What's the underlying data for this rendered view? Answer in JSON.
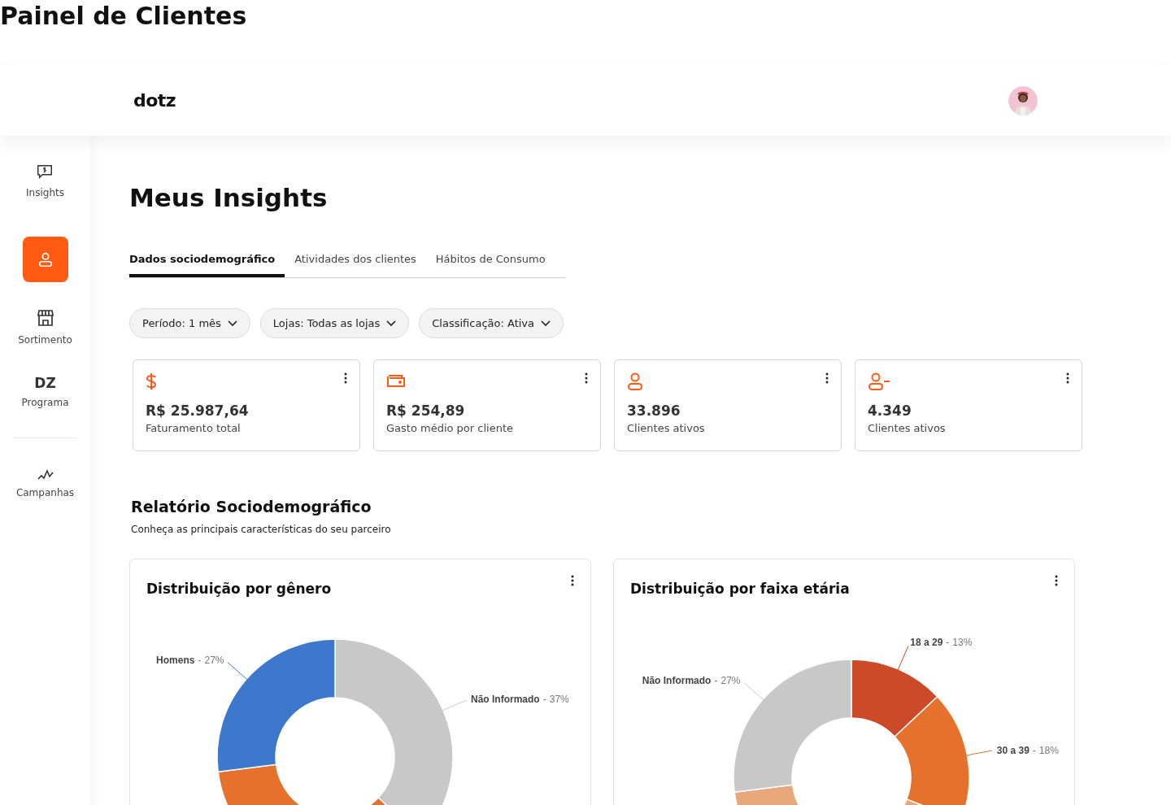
{
  "page_title": "Painel de Clientes",
  "header": {
    "logo": "dotz"
  },
  "sidebar": {
    "items": [
      {
        "label": "Insights",
        "selected": false
      },
      {
        "selected": true
      },
      {
        "label": "Sortimento",
        "selected": false
      },
      {
        "label": "Programa",
        "icon_text": "DZ",
        "selected": false
      },
      {
        "label": "Campanhas",
        "selected": false
      }
    ]
  },
  "main": {
    "title": "Meus Insights",
    "tabs": [
      {
        "label": "Dados sociodemográfico",
        "selected": true
      },
      {
        "label": "Atividades dos clientes",
        "selected": false
      },
      {
        "label": "Hábitos de Consumo",
        "selected": false
      }
    ],
    "filters": [
      {
        "label": "Período: 1 mês"
      },
      {
        "label": "Lojas: Todas as lojas"
      },
      {
        "label": "Classificação: Ativa"
      }
    ],
    "stats": [
      {
        "kind": "dollar",
        "value": "R$ 25.987,64",
        "label": "Faturamento total"
      },
      {
        "kind": "wallet",
        "value": "R$ 254,89",
        "label": "Gasto médio por cliente"
      },
      {
        "kind": "user",
        "value": "33.896",
        "label": "Clientes ativos"
      },
      {
        "kind": "user-minus",
        "value": "4.349",
        "label": "Clientes ativos"
      }
    ],
    "report": {
      "title": "Relatório Sociodemográfico",
      "subtitle": "Conheça as principais características do seu parceiro",
      "charts": [
        {
          "title": "Distribuição por gênero",
          "label_separator": "-",
          "chart_data": {
            "type": "donut",
            "categories": [
              "Não Informado",
              null,
              "Homens"
            ],
            "values": [
              37,
              36,
              27
            ],
            "colors": [
              "#c8c8c8",
              "#e5712d",
              "#3d78cc"
            ],
            "value_labels": [
              "37%",
              null,
              "27%"
            ]
          }
        },
        {
          "title": "Distribuição por faixa etária",
          "label_separator": "-",
          "chart_data": {
            "type": "donut",
            "categories": [
              "18 a 29",
              "30 a 39",
              null,
              "Não Informado"
            ],
            "values": [
              13,
              18,
              42,
              27
            ],
            "colors": [
              "#cc4a28",
              "#e5712d",
              "#e8a87c",
              "#c8c8c8"
            ],
            "value_labels": [
              "13%",
              "18%",
              null,
              "27%"
            ]
          }
        }
      ]
    }
  }
}
